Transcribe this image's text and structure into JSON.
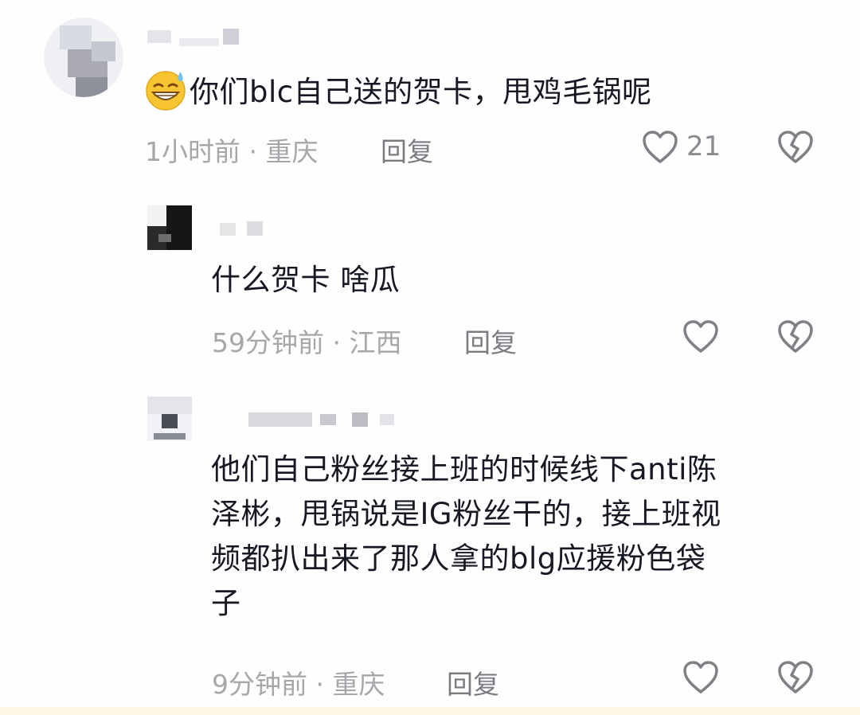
{
  "comments": [
    {
      "text": "你们blc自己送的贺卡，甩鸡毛锅呢",
      "emoji": "sweat-grin-emoji",
      "meta": "1小时前 · 重庆",
      "reply_label": "回复",
      "like_count": "21"
    },
    {
      "text": "什么贺卡 啥瓜",
      "meta": "59分钟前 · 江西",
      "reply_label": "回复"
    },
    {
      "text_lines": [
        "他们自己粉丝接上班的时候线下anti陈",
        "泽彬，甩锅说是IG粉丝干的，接上班视",
        "频都扒出来了那人拿的blg应援粉色袋",
        "子"
      ],
      "meta": "9分钟前 · 重庆",
      "reply_label": "回复"
    }
  ],
  "icons": {
    "like": "heart-outline-icon",
    "dislike": "broken-heart-icon"
  },
  "colors": {
    "text": "#161823",
    "meta": "#a6a7ab",
    "reply": "#7a7c82",
    "icon": "#7f8085"
  }
}
